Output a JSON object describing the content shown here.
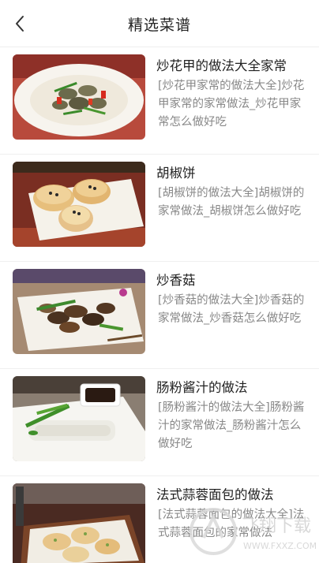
{
  "header": {
    "title": "精选菜谱",
    "back_icon": "chevron-left-icon"
  },
  "recipes": [
    {
      "title": "炒花甲的做法大全家常",
      "desc": "[炒花甲家常的做法大全]炒花甲家常的家常做法_炒花甲家常怎么做好吃"
    },
    {
      "title": "胡椒饼",
      "desc": "[胡椒饼的做法大全]胡椒饼的家常做法_胡椒饼怎么做好吃"
    },
    {
      "title": "炒香菇",
      "desc": "[炒香菇的做法大全]炒香菇的家常做法_炒香菇怎么做好吃"
    },
    {
      "title": "肠粉酱汁的做法",
      "desc": "[肠粉酱汁的做法大全]肠粉酱汁的家常做法_肠粉酱汁怎么做好吃"
    },
    {
      "title": "法式蒜蓉面包的做法",
      "desc": "[法式蒜蓉面包的做法大全]法式蒜蓉面包的家常做法"
    }
  ],
  "watermark": {
    "text": "飞翔下载",
    "url": "WWW.FXXZ.COM"
  }
}
